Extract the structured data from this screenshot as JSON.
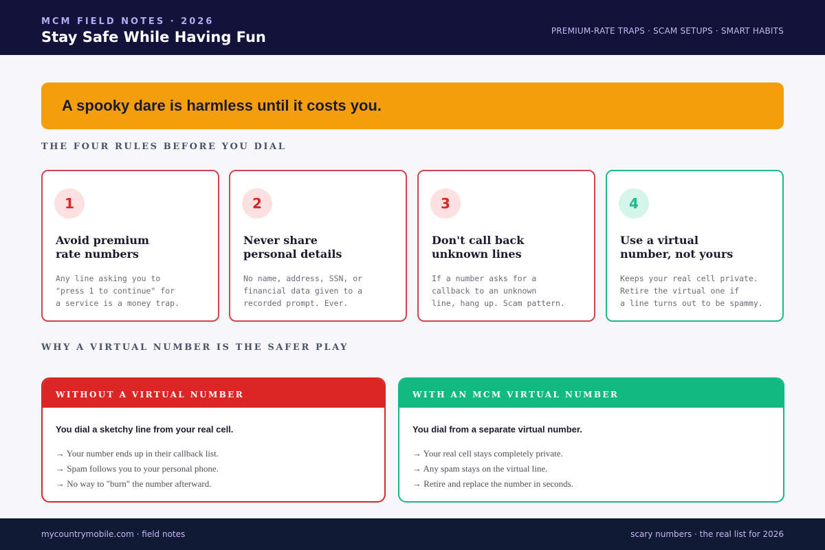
{
  "header": {
    "kicker": "MCM FIELD NOTES · 2026",
    "title": "Stay Safe While Having Fun",
    "tagline": "PREMIUM-RATE TRAPS · SCAM SETUPS · SMART HABITS"
  },
  "banner": {
    "text": "A spooky dare is harmless until it costs you.",
    "color": "#f59e0b"
  },
  "sections": {
    "rules_title": "THE FOUR RULES BEFORE YOU DIAL",
    "compare_title": "WHY A VIRTUAL NUMBER IS THE SAFER PLAY"
  },
  "rules": [
    {
      "number": "1",
      "title": "Avoid premium\nrate numbers",
      "body": "Any line asking you to\n\"press 1 to continue\" for\na service is a money trap."
    },
    {
      "number": "2",
      "title": "Never share\npersonal details",
      "body": "No name, address, SSN, or\nfinancial data given to a\nrecorded prompt. Ever."
    },
    {
      "number": "3",
      "title": "Don't call back\nunknown lines",
      "body": "If a number asks for a\ncallback to an unknown\nline, hang up. Scam pattern."
    },
    {
      "number": "4",
      "title": "Use a virtual\nnumber, not yours",
      "body": "Keeps your real cell private.\nRetire the virtual one if\na line turns out to be spammy."
    }
  ],
  "comparison": {
    "without": {
      "header": "WITHOUT A VIRTUAL NUMBER",
      "lead": "You dial a sketchy line from your real cell.",
      "items": [
        "→ Your number ends up in their callback list.",
        "→ Spam follows you to your personal phone.",
        "→ No way to \"burn\" the number afterward."
      ]
    },
    "with": {
      "header": "WITH AN MCM VIRTUAL NUMBER",
      "lead": "You dial from a separate virtual number.",
      "items": [
        "→ Your real cell stays completely private.",
        "→ Any spam stays on the virtual line.",
        "→ Retire and replace the number in seconds."
      ]
    }
  },
  "footer": {
    "left": "mycountrymobile.com · field notes",
    "right": "scary numbers · the real list for 2026"
  },
  "colors": {
    "header_bg": "#12123a",
    "danger": "#dc2626",
    "safe": "#12b981",
    "accent": "#f59e0b"
  }
}
